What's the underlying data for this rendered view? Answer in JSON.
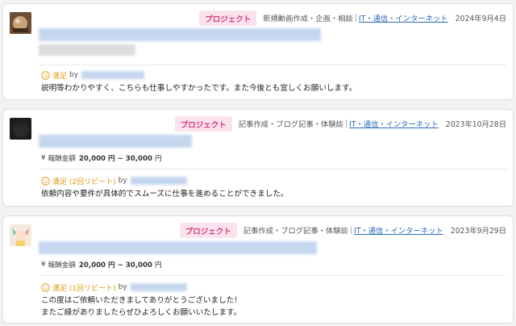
{
  "reviews": [
    {
      "badge": "プロジェクト",
      "category": "新規動画作成・企画・相談",
      "separator": "|",
      "industry": "IT・通信・インターネット",
      "date": "2024年9月4日",
      "rating": "満足",
      "by": "by",
      "comment": "説明等わかりやすく、こちらも仕事しやすかったです。また今後とも宜しくお願いします。"
    },
    {
      "badge": "プロジェクト",
      "category": "記事作成・ブログ記事・体験談",
      "separator": "|",
      "industry": "IT・通信・インターネット",
      "date": "2023年10月28日",
      "fee_label": "報酬金額",
      "fee_value": "20,000 円 ~ 30,000",
      "fee_unit": "円",
      "rating": "満足 (2回リピート)",
      "by": "by",
      "comment": "依頼内容や要件が具体的でスムーズに仕事を進めることができました。"
    },
    {
      "badge": "プロジェクト",
      "category": "記事作成・ブログ記事・体験談",
      "separator": "|",
      "industry": "IT・通信・インターネット",
      "date": "2023年9月29日",
      "fee_label": "報酬金額",
      "fee_value": "20,000 円 ~ 30,000",
      "fee_unit": "円",
      "rating": "満足 (1回リピート)",
      "by": "by",
      "comment": "この度はご依頼いただきましてありがとうございました！",
      "comment_2": "またご縁がありましたらぜひよろしくお願いいたします。"
    }
  ],
  "colors": {
    "badge_bg": "#fbe3ee",
    "badge_text": "#d23c78",
    "link": "#2a6bb8",
    "rating": "#e19a15"
  },
  "icons": {
    "rating": "smile-icon",
    "fee": "yen-icon"
  }
}
